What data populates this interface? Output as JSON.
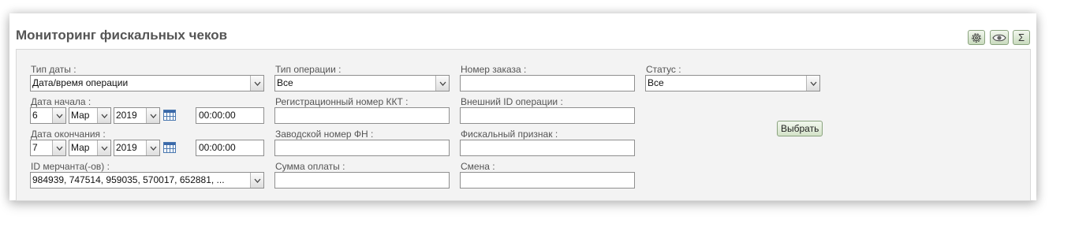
{
  "page": {
    "title": "Мониторинг фискальных чеков"
  },
  "toolbar": {
    "sum_symbol": "Σ",
    "icons": [
      "gear-icon",
      "eye-icon",
      "sigma-icon"
    ]
  },
  "filters": {
    "date_type": {
      "label": "Тип даты :",
      "value": "Дата/время операции"
    },
    "date_start": {
      "label": "Дата начала :",
      "day": "6",
      "month": "Мар",
      "year": "2019",
      "time": "00:00:00"
    },
    "date_end": {
      "label": "Дата окончания :",
      "day": "7",
      "month": "Мар",
      "year": "2019",
      "time": "00:00:00"
    },
    "merchant": {
      "label": "ID мерчанта(-ов) :",
      "value": "984939, 747514, 959035, 570017, 652881, ..."
    },
    "operation_type": {
      "label": "Тип операции :",
      "value": "Все"
    },
    "kkt_reg": {
      "label": "Регистрационный номер ККТ :",
      "value": ""
    },
    "fn_number": {
      "label": "Заводской номер ФН :",
      "value": ""
    },
    "payment_sum": {
      "label": "Сумма оплаты :",
      "value": ""
    },
    "order_number": {
      "label": "Номер заказа :",
      "value": ""
    },
    "external_id": {
      "label": "Внешний ID операции :",
      "value": ""
    },
    "fiscal_sign": {
      "label": "Фискальный признак :",
      "value": ""
    },
    "shift": {
      "label": "Смена :",
      "value": ""
    },
    "status": {
      "label": "Статус :",
      "value": "Все"
    },
    "submit_label": "Выбрать"
  }
}
